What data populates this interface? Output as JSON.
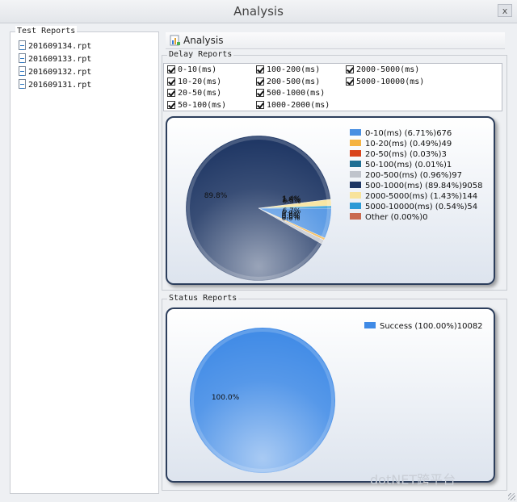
{
  "window": {
    "title": "Analysis",
    "close": "x"
  },
  "left_panel": {
    "title": "Test Reports",
    "files": [
      "201609134.rpt",
      "201609133.rpt",
      "201609132.rpt",
      "201609131.rpt"
    ]
  },
  "tab": {
    "label": "Analysis"
  },
  "delay": {
    "title": "Delay Reports",
    "filters": [
      {
        "label": "0-10(ms)",
        "checked": true
      },
      {
        "label": "10-20(ms)",
        "checked": true
      },
      {
        "label": "20-50(ms)",
        "checked": true
      },
      {
        "label": "50-100(ms)",
        "checked": true
      },
      {
        "label": "100-200(ms)",
        "checked": true
      },
      {
        "label": "200-500(ms)",
        "checked": true
      },
      {
        "label": "500-1000(ms)",
        "checked": true
      },
      {
        "label": "1000-2000(ms)",
        "checked": true
      },
      {
        "label": "2000-5000(ms)",
        "checked": true
      },
      {
        "label": "5000-10000(ms)",
        "checked": true
      }
    ]
  },
  "status": {
    "title": "Status Reports"
  },
  "watermark": "dotNET跨平台",
  "chart_data": [
    {
      "type": "pie",
      "slices": [
        {
          "label": "0-10(ms) (6.71%)676",
          "value": 6.71,
          "color": "#4a90e2"
        },
        {
          "label": "10-20(ms) (0.49%)49",
          "value": 0.49,
          "color": "#f5b342"
        },
        {
          "label": "20-50(ms) (0.03%)3",
          "value": 0.03,
          "color": "#d9441c"
        },
        {
          "label": "50-100(ms) (0.01%)1",
          "value": 0.01,
          "color": "#1f6e93"
        },
        {
          "label": "200-500(ms) (0.96%)97",
          "value": 0.96,
          "color": "#c0c4cc"
        },
        {
          "label": "500-1000(ms) (89.84%)9058",
          "value": 89.84,
          "color": "#1d3563"
        },
        {
          "label": "2000-5000(ms) (1.43%)144",
          "value": 1.43,
          "color": "#f8e39a"
        },
        {
          "label": "5000-10000(ms) (0.54%)54",
          "value": 0.54,
          "color": "#2b9ad6"
        },
        {
          "label": "Other (0.00%)0",
          "value": 0.0,
          "color": "#c96a4f"
        }
      ],
      "pie_labels": [
        "6.7%",
        "0.5%",
        "0.0%",
        "0.0%",
        "1.0%",
        "89.8%",
        "1.4%",
        "0.5%",
        "0.0%"
      ]
    },
    {
      "type": "pie",
      "slices": [
        {
          "label": "Success (100.00%)10082",
          "value": 100.0,
          "color": "#3f8ae6"
        }
      ],
      "pie_labels": [
        "100.0%"
      ]
    }
  ]
}
